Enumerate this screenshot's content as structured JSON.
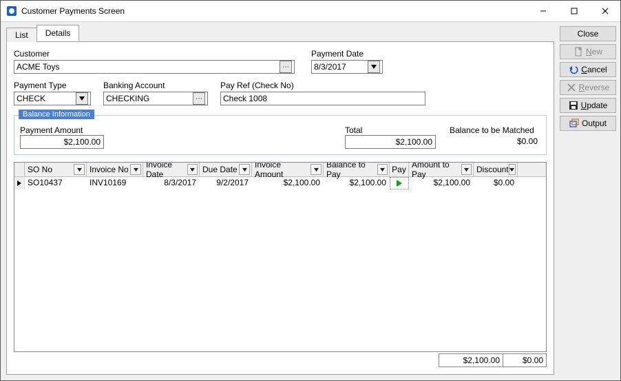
{
  "window_title": "Customer Payments Screen",
  "tabs": [
    "List",
    "Details"
  ],
  "active_tab": 1,
  "customer_label": "Customer",
  "customer_value": "ACME Toys",
  "payment_date_label": "Payment Date",
  "payment_date_value": "8/3/2017",
  "payment_type_label": "Payment Type",
  "payment_type_value": "CHECK",
  "banking_account_label": "Banking Account",
  "banking_account_value": "CHECKING",
  "pay_ref_label": "Pay Ref (Check No)",
  "pay_ref_value": "Check 1008",
  "balance_group_title": "Balance Information",
  "payment_amount_label": "Payment Amount",
  "payment_amount_value": "$2,100.00",
  "total_label": "Total",
  "total_value": "$2,100.00",
  "balance_to_match_label": "Balance to be Matched",
  "balance_to_match_value": "$0.00",
  "grid": {
    "columns": [
      {
        "label": "SO No",
        "width": 90,
        "filter": true
      },
      {
        "label": "Invoice No",
        "width": 82,
        "filter": true
      },
      {
        "label": "Invoice Date",
        "width": 82,
        "filter": true
      },
      {
        "label": "Due Date",
        "width": 76,
        "filter": true
      },
      {
        "label": "Invoice Amount",
        "width": 104,
        "filter": true
      },
      {
        "label": "Balance to Pay",
        "width": 96,
        "filter": true
      },
      {
        "label": "Pay",
        "width": 28,
        "filter": false
      },
      {
        "label": "Amount to Pay",
        "width": 94,
        "filter": true
      },
      {
        "label": "Discount",
        "width": 64,
        "filter": true
      }
    ],
    "rows": [
      {
        "so_no": "SO10437",
        "invoice_no": "INV10169",
        "invoice_date": "8/3/2017",
        "due_date": "9/2/2017",
        "invoice_amount": "$2,100.00",
        "balance_to_pay": "$2,100.00",
        "pay": true,
        "amount_to_pay": "$2,100.00",
        "discount": "$0.00"
      }
    ],
    "footer": {
      "amount_to_pay": "$2,100.00",
      "discount": "$0.00"
    }
  },
  "side_buttons": {
    "close": "Close",
    "new": "New",
    "cancel": "Cancel",
    "reverse": "Reverse",
    "update": "Update",
    "output": "Output"
  }
}
